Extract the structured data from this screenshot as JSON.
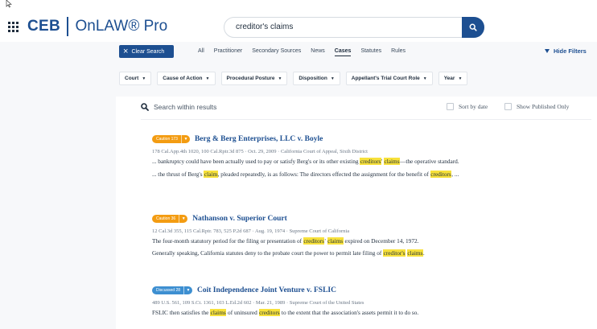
{
  "brand": {
    "name": "CEB",
    "product": "OnLAW® Pro"
  },
  "search": {
    "query": "creditor's claims"
  },
  "toolbar": {
    "clear_label": "Clear Search",
    "tabs": [
      {
        "label": "All"
      },
      {
        "label": "Practitioner"
      },
      {
        "label": "Secondary Sources"
      },
      {
        "label": "News"
      },
      {
        "label": "Cases",
        "active": true
      },
      {
        "label": "Statutes"
      },
      {
        "label": "Rules"
      }
    ],
    "hide_filters_label": "Hide Filters"
  },
  "filters": [
    {
      "label": "Court"
    },
    {
      "label": "Cause of Action"
    },
    {
      "label": "Procedural Posture"
    },
    {
      "label": "Disposition"
    },
    {
      "label": "Appellant's Trial Court Role"
    },
    {
      "label": "Year"
    }
  ],
  "within": {
    "placeholder": "Search within results",
    "sort_label": "Sort by date",
    "published_label": "Show Published Only"
  },
  "results": [
    {
      "badge": {
        "label": "Caution 173",
        "kind": "caution"
      },
      "title": "Berg & Berg Enterprises, LLC v. Boyle",
      "cite": "178 Cal.App.4th 1020, 100 Cal.Rptr.3d 875  ·  Oct. 29, 2009  ·  California Court of Appeal, Sixth District",
      "snippets": [
        [
          {
            "t": "... bankruptcy could have been actually used to pay or satisfy Berg's or its other existing "
          },
          {
            "t": "creditors",
            "hl": true
          },
          {
            "t": "' "
          },
          {
            "t": "claims",
            "hl": true
          },
          {
            "t": "—the operative standard."
          }
        ],
        [
          {
            "t": "... the thrust of Berg's "
          },
          {
            "t": "claim",
            "hl": true
          },
          {
            "t": ", pleaded repeatedly, is as follows: The directors effected the assignment for the benefit of "
          },
          {
            "t": "creditors",
            "hl": true
          },
          {
            "t": ", ..."
          }
        ]
      ]
    },
    {
      "badge": {
        "label": "Caution 36",
        "kind": "caution"
      },
      "title": "Nathanson v. Superior Court",
      "cite": "12 Cal.3d 355, 115 Cal.Rptr. 783, 525 P.2d 687  ·  Aug. 19, 1974  ·  Supreme Court of California",
      "snippets": [
        [
          {
            "t": "The four-month statutory period for the filing or presentation of "
          },
          {
            "t": "creditors",
            "hl": true
          },
          {
            "t": "' "
          },
          {
            "t": "claims",
            "hl": true
          },
          {
            "t": " expired on December 14, 1972."
          }
        ],
        [
          {
            "t": "Generally speaking, California statutes deny to the probate court the power to permit late filing of "
          },
          {
            "t": "creditor's",
            "hl": true
          },
          {
            "t": " "
          },
          {
            "t": "claims",
            "hl": true
          },
          {
            "t": "."
          }
        ]
      ]
    },
    {
      "badge": {
        "label": "Discussed 28",
        "kind": "discussed"
      },
      "title": "Coit Independence Joint Venture v. FSLIC",
      "cite": "489 U.S. 561, 109 S.Ct. 1361, 103 L.Ed.2d 602  ·  Mar. 21, 1989  ·  Supreme Court of the United States",
      "snippets": [
        [
          {
            "t": "FSLIC then satisfies the "
          },
          {
            "t": "claims",
            "hl": true
          },
          {
            "t": " of uninsured "
          },
          {
            "t": "creditors",
            "hl": true
          },
          {
            "t": " to the extent that the association's assets permit it to do so."
          }
        ]
      ]
    }
  ]
}
